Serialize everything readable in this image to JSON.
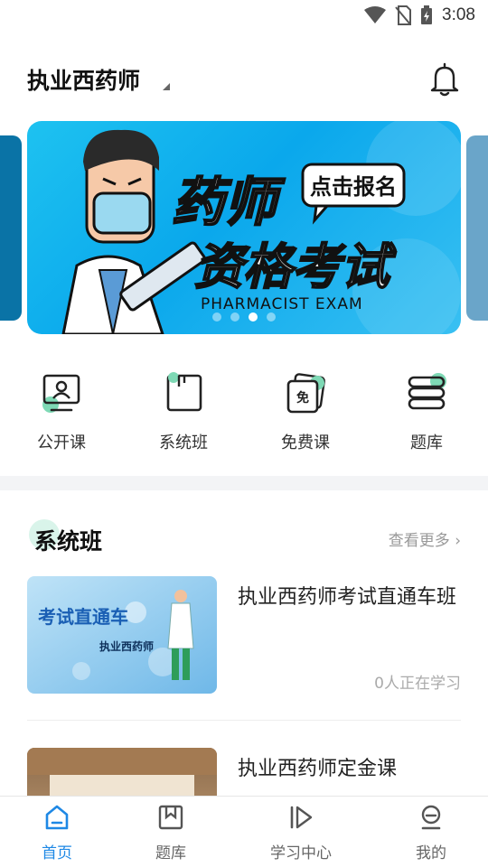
{
  "status_bar": {
    "time": "3:08"
  },
  "header": {
    "title": "执业西药师"
  },
  "banner": {
    "title_line1": "药师",
    "title_line2": "资格考试",
    "badge": "点击报名",
    "subtitle": "PHARMACIST EXAM",
    "active_dot": 3,
    "dot_count": 4
  },
  "quick_menu": [
    {
      "label": "公开课",
      "icon": "monitor-person-icon"
    },
    {
      "label": "系统班",
      "icon": "book-icon"
    },
    {
      "label": "免费课",
      "icon": "free-ticket-icon"
    },
    {
      "label": "题库",
      "icon": "stack-icon"
    }
  ],
  "section": {
    "title": "系统班",
    "see_more": "查看更多"
  },
  "courses": [
    {
      "title": "执业西药师考试直通车班",
      "thumb_heading": "考试直通车",
      "thumb_sub": "执业西药师",
      "learners": "0人正在学习"
    },
    {
      "title": "执业西药师定金课"
    }
  ],
  "bottom_nav": [
    {
      "label": "首页",
      "icon": "home-icon",
      "active": true
    },
    {
      "label": "题库",
      "icon": "bookmark-icon",
      "active": false
    },
    {
      "label": "学习中心",
      "icon": "play-icon",
      "active": false
    },
    {
      "label": "我的",
      "icon": "profile-icon",
      "active": false
    }
  ],
  "colors": {
    "accent": "#1e88e5",
    "mint": "#7ed9b5",
    "banner": "#0aa8ec"
  }
}
